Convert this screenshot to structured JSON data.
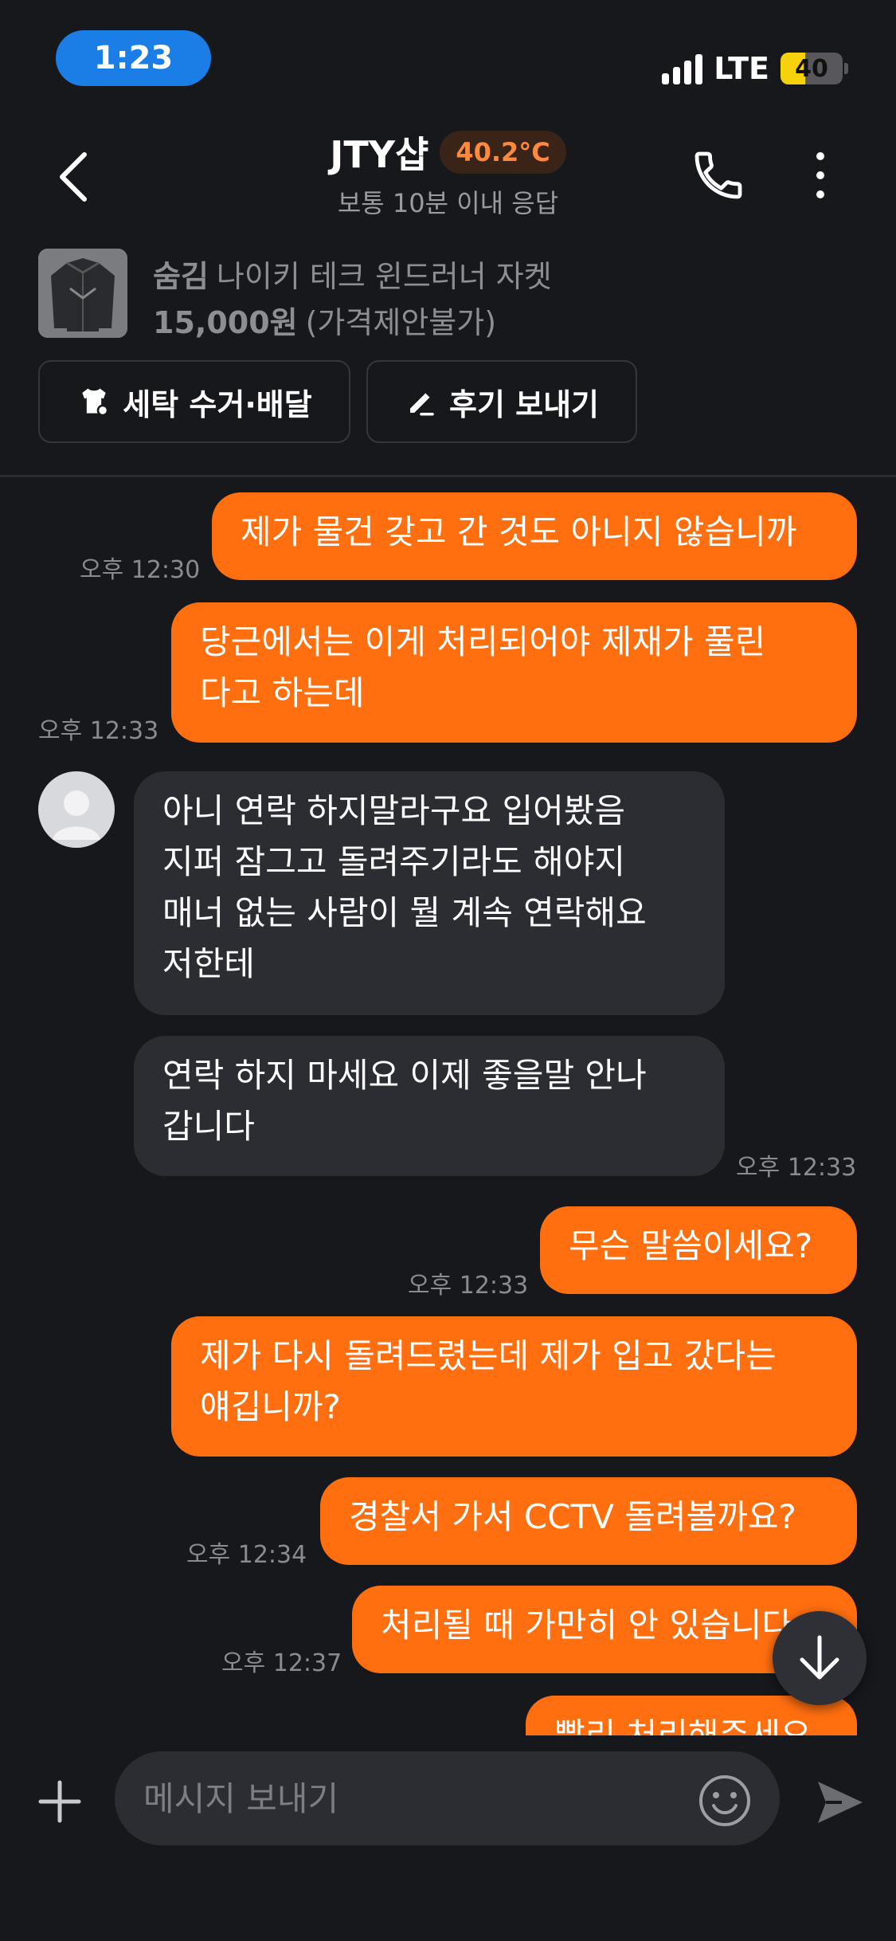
{
  "status_bar": {
    "time": "1:23",
    "network": "LTE",
    "battery": "40"
  },
  "header": {
    "title": "JTY샵",
    "temperature": "40.2°C",
    "response_time": "보통 10분 이내 응답"
  },
  "product": {
    "status_tag": "숨김",
    "name": "나이키 테크 윈드러너 자켓",
    "price": "15,000원",
    "price_note": "(가격제안불가)"
  },
  "actions": {
    "laundry_label": "세탁 수거·배달",
    "review_label": "후기 보내기"
  },
  "messages": [
    {
      "sender": "me",
      "text": "제가 물건 갖고 간 것도 아니지 않습니까",
      "time": "오후 12:30"
    },
    {
      "sender": "me",
      "text": "당근에서는 이게 처리되어야 제재가 풀린\n다고 하는데",
      "time": "오후 12:33"
    },
    {
      "sender": "them",
      "text": "아니 연락 하지말라구요 입어봤음\n지퍼 잠그고 돌려주기라도 해야지\n매너 없는 사람이 뭘 계속 연락해요\n저한테",
      "time": ""
    },
    {
      "sender": "them",
      "text": "연락 하지 마세요 이제 좋을말 안나\n갑니다",
      "time": "오후 12:33"
    },
    {
      "sender": "me",
      "text": "무슨 말씀이세요?",
      "time": "오후 12:33"
    },
    {
      "sender": "me",
      "text": "제가 다시 돌려드렸는데 제가 입고 갔다는\n얘깁니까?",
      "time": ""
    },
    {
      "sender": "me",
      "text": "경찰서 가서 CCTV 돌려볼까요?",
      "time": "오후 12:34"
    },
    {
      "sender": "me",
      "text": "처리될 때 가만히 안 있습니다",
      "time": "오후 12:37"
    },
    {
      "sender": "me",
      "text": "빨리 처리해주세요",
      "time": ""
    }
  ],
  "composer": {
    "placeholder": "메시지 보내기"
  },
  "colors": {
    "accent": "#ff6f0f",
    "background": "#17181c",
    "bubble_them": "#2c2d33",
    "time_pill": "#1a7ee6"
  }
}
